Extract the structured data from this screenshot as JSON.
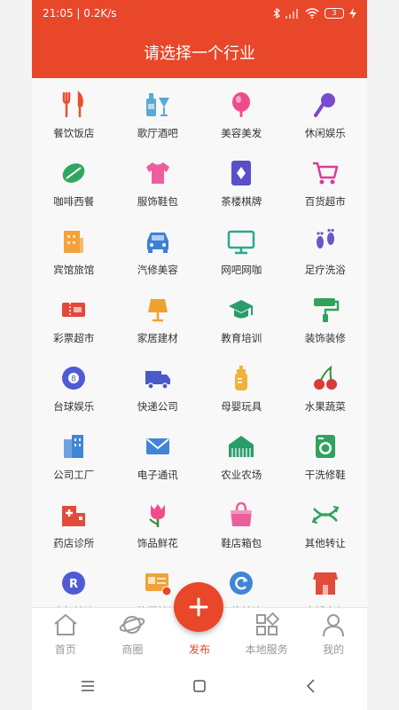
{
  "status_bar": {
    "time": "21:05",
    "speed": "0.2K/s",
    "battery_level": "3"
  },
  "header": {
    "title": "请选择一个行业"
  },
  "categories": [
    {
      "label": "餐饮饭店",
      "icon": "utensils-icon",
      "color": "#e8502e"
    },
    {
      "label": "歌厅酒吧",
      "icon": "bottle-glass-icon",
      "color": "#5aa9d6"
    },
    {
      "label": "美容美发",
      "icon": "mirror-icon",
      "color": "#f04c8c"
    },
    {
      "label": "休闲娱乐",
      "icon": "microphone-icon",
      "color": "#7a4ad0"
    },
    {
      "label": "咖啡西餐",
      "icon": "coffee-bean-icon",
      "color": "#2fa760"
    },
    {
      "label": "服饰鞋包",
      "icon": "tshirt-icon",
      "color": "#ef5e9c"
    },
    {
      "label": "茶楼棋牌",
      "icon": "playing-card-icon",
      "color": "#5a4fc8"
    },
    {
      "label": "百货超市",
      "icon": "shopping-cart-icon",
      "color": "#d93d9a"
    },
    {
      "label": "宾馆旅馆",
      "icon": "hotel-building-icon",
      "color": "#f2a23a"
    },
    {
      "label": "汽修美容",
      "icon": "car-icon",
      "color": "#3f7fd6"
    },
    {
      "label": "网吧网咖",
      "icon": "monitor-icon",
      "color": "#2aa88f"
    },
    {
      "label": "足疗洗浴",
      "icon": "footprints-icon",
      "color": "#6a56c8"
    },
    {
      "label": "彩票超市",
      "icon": "lottery-ticket-icon",
      "color": "#e24b3a"
    },
    {
      "label": "家居建材",
      "icon": "lamp-icon",
      "color": "#f0a22e"
    },
    {
      "label": "教育培训",
      "icon": "graduation-cap-icon",
      "color": "#2a9c6c"
    },
    {
      "label": "装饰装修",
      "icon": "paint-roller-icon",
      "color": "#2fa35c"
    },
    {
      "label": "台球娱乐",
      "icon": "billiard-ball-icon",
      "color": "#4e5bd4"
    },
    {
      "label": "快递公司",
      "icon": "truck-icon",
      "color": "#4a5ac8"
    },
    {
      "label": "母婴玩具",
      "icon": "baby-bottle-icon",
      "color": "#f2b23a"
    },
    {
      "label": "水果蔬菜",
      "icon": "cherries-icon",
      "color": "#d93a3a"
    },
    {
      "label": "公司工厂",
      "icon": "office-building-icon",
      "color": "#3f86d6"
    },
    {
      "label": "电子通讯",
      "icon": "envelope-icon",
      "color": "#3f86d6"
    },
    {
      "label": "农业农场",
      "icon": "farm-barn-icon",
      "color": "#2a9c6c"
    },
    {
      "label": "干洗修鞋",
      "icon": "washing-machine-icon",
      "color": "#2fa35c"
    },
    {
      "label": "药店诊所",
      "icon": "hospital-icon",
      "color": "#e24b3a"
    },
    {
      "label": "饰品鲜花",
      "icon": "tulip-icon",
      "color": "#f04c8c"
    },
    {
      "label": "鞋店箱包",
      "icon": "handbag-icon",
      "color": "#ef5e9c"
    },
    {
      "label": "其他转让",
      "icon": "transfer-arrows-icon",
      "color": "#2fa35c"
    },
    {
      "label": "商标转让",
      "icon": "trademark-icon",
      "color": "#4e5bd4"
    },
    {
      "label": "执照转让",
      "icon": "license-card-icon",
      "color": "#f2a23a"
    },
    {
      "label": "网络转让",
      "icon": "refresh-icon",
      "color": "#3f86d6"
    },
    {
      "label": "商铺出租",
      "icon": "storefront-icon",
      "color": "#e24b3a"
    }
  ],
  "bottom_nav": {
    "items": [
      {
        "label": "首页",
        "icon": "home-icon"
      },
      {
        "label": "商圈",
        "icon": "planet-icon"
      },
      {
        "label": "发布",
        "icon": "plus-icon"
      },
      {
        "label": "本地服务",
        "icon": "apps-grid-icon"
      },
      {
        "label": "我的",
        "icon": "person-icon"
      }
    ],
    "active_color": "#e8472a",
    "inactive_color": "#999999"
  },
  "colors": {
    "brand": "#e8472a"
  }
}
